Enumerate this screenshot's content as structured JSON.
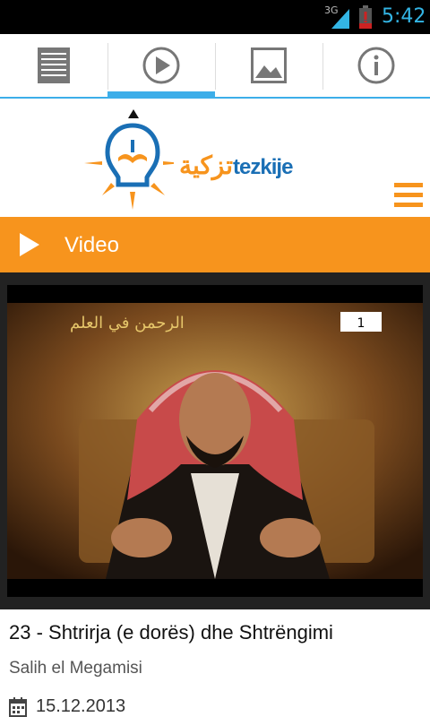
{
  "status_bar": {
    "network": "3G",
    "time": "5:42"
  },
  "tabs": [
    {
      "name": "list",
      "icon": "list-icon",
      "active": false
    },
    {
      "name": "video",
      "icon": "play-circle-icon",
      "active": true
    },
    {
      "name": "images",
      "icon": "image-icon",
      "active": false
    },
    {
      "name": "info",
      "icon": "info-icon",
      "active": false
    }
  ],
  "logo": {
    "arabic": "تزكية",
    "latin": "tezkije"
  },
  "section": {
    "title": "Video",
    "icon": "play-icon"
  },
  "video": {
    "overlay_text": "الرحمن في العلم",
    "channel_logo": "1",
    "title": "23 - Shtrirja (e dorës) dhe Shtrëngimi",
    "author": "Salih el Megamisi",
    "date": "15.12.2013",
    "date_icon": "calendar-icon"
  },
  "colors": {
    "accent_blue": "#3daee9",
    "brand_orange": "#f7941d",
    "brand_blue": "#1a6fb5"
  }
}
